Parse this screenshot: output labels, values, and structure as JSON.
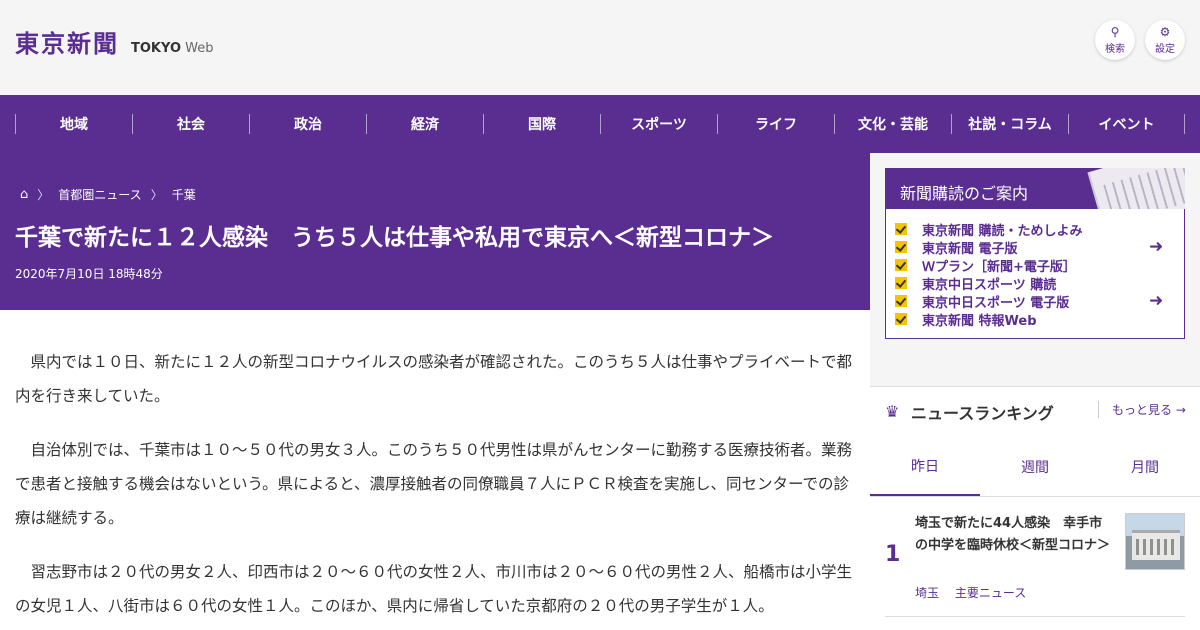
{
  "header": {
    "logo_jp": "東京新聞",
    "logo_en_bold": "TOKYO",
    "logo_en_light": "Web",
    "search_label": "検索",
    "settings_label": "設定"
  },
  "nav": {
    "items": [
      "地域",
      "社会",
      "政治",
      "経済",
      "国際",
      "スポーツ",
      "ライフ",
      "文化・芸能",
      "社説・コラム",
      "イベント"
    ]
  },
  "breadcrumb": {
    "items": [
      "首都圏ニュース",
      "千葉"
    ]
  },
  "article": {
    "title": "千葉で新たに１２人感染　うち５人は仕事や私用で東京へ＜新型コロナ＞",
    "date": "2020年7月10日 18時48分",
    "paragraphs": [
      "県内では１０日、新たに１２人の新型コロナウイルスの感染者が確認された。このうち５人は仕事やプライベートで都内を行き来していた。",
      "自治体別では、千葉市は１０～５０代の男女３人。このうち５０代男性は県がんセンターに勤務する医療技術者。業務で患者と接触する機会はないという。県によると、濃厚接触者の同僚職員７人にＰＣＲ検査を実施し、同センターでの診療は継続する。",
      "習志野市は２０代の男女２人、印西市は２０～６０代の女性２人、市川市は２０～６０代の男性２人、船橋市は小学生の女児１人、八街市は６０代の女性１人。このほか、県内に帰省していた京都府の２０代の男子学生が１人。"
    ]
  },
  "subscription": {
    "title": "新聞購読のご案内",
    "items": [
      "東京新聞 購読・ためしよみ",
      "東京新聞 電子版",
      "Ｗプラン［新聞+電子版］",
      "東京中日スポーツ 購読",
      "東京中日スポーツ 電子版",
      "東京新聞 特報Web"
    ]
  },
  "ranking": {
    "title": "ニュースランキング",
    "more": "もっと見る",
    "tabs": [
      "昨日",
      "週間",
      "月間"
    ],
    "items": [
      {
        "rank": "1",
        "title": "埼玉で新たに44人感染　幸手市の中学を臨時休校＜新型コロナ＞",
        "tags": [
          "埼玉",
          "主要ニュース"
        ]
      }
    ]
  },
  "colors": {
    "brand": "#5a2d91",
    "accent": "#f5c400"
  }
}
